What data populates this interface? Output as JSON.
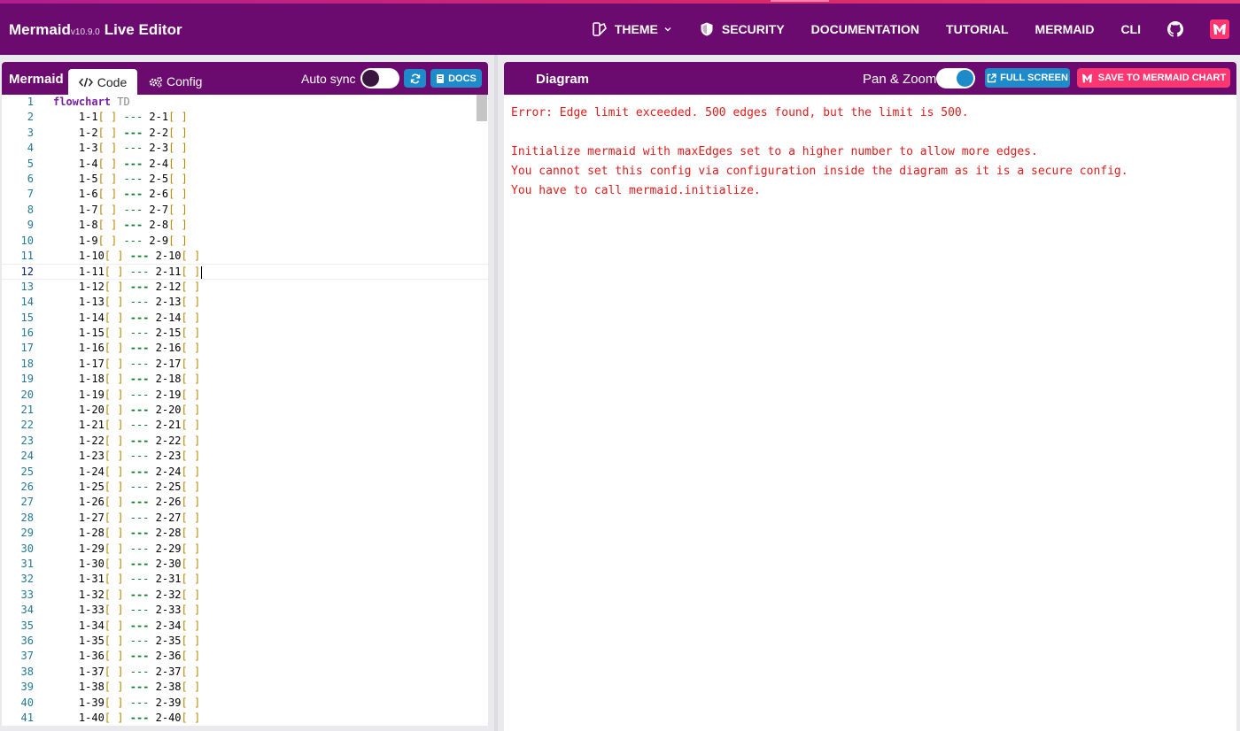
{
  "header": {
    "brand": "Mermaid",
    "version": "v10.9.0",
    "subtitle": "Live Editor",
    "nav": {
      "theme": "THEME",
      "security": "SECURITY",
      "documentation": "DOCUMENTATION",
      "tutorial": "TUTORIAL",
      "mermaid": "MERMAID",
      "cli": "CLI"
    },
    "icons": [
      "theme-icon",
      "chevron-down-icon",
      "shield-icon",
      "github-icon",
      "mermaid-chart-icon"
    ]
  },
  "editor_panel": {
    "title": "Mermaid",
    "tab_code": "Code",
    "tab_config": "Config",
    "auto_sync_label": "Auto sync",
    "auto_sync_on": false,
    "docs_label": "DOCS"
  },
  "code": {
    "first_line": {
      "keyword": "flowchart",
      "direction": "TD"
    },
    "edges_visible": 40,
    "first_line_number": 1,
    "last_visible_line": 41,
    "current_line": 12
  },
  "diagram_panel": {
    "title": "Diagram",
    "pan_zoom_label": "Pan & Zoom",
    "pan_zoom_on": true,
    "full_screen_label": "FULL SCREEN",
    "save_label": "SAVE TO MERMAID CHART",
    "error_lines": [
      "Error: Edge limit exceeded. 500 edges found, but the limit is 500.",
      "",
      "Initialize mermaid with maxEdges set to a higher number to allow more edges.",
      "You cannot set this config via configuration inside the diagram as it is a secure config.",
      "You have to call mermaid.initialize."
    ]
  },
  "colors": {
    "brand_purple": "#6b0a6f",
    "accent_blue": "#1d8ac9",
    "accent_pink": "#ff3670",
    "error_red": "#e01b1b"
  }
}
